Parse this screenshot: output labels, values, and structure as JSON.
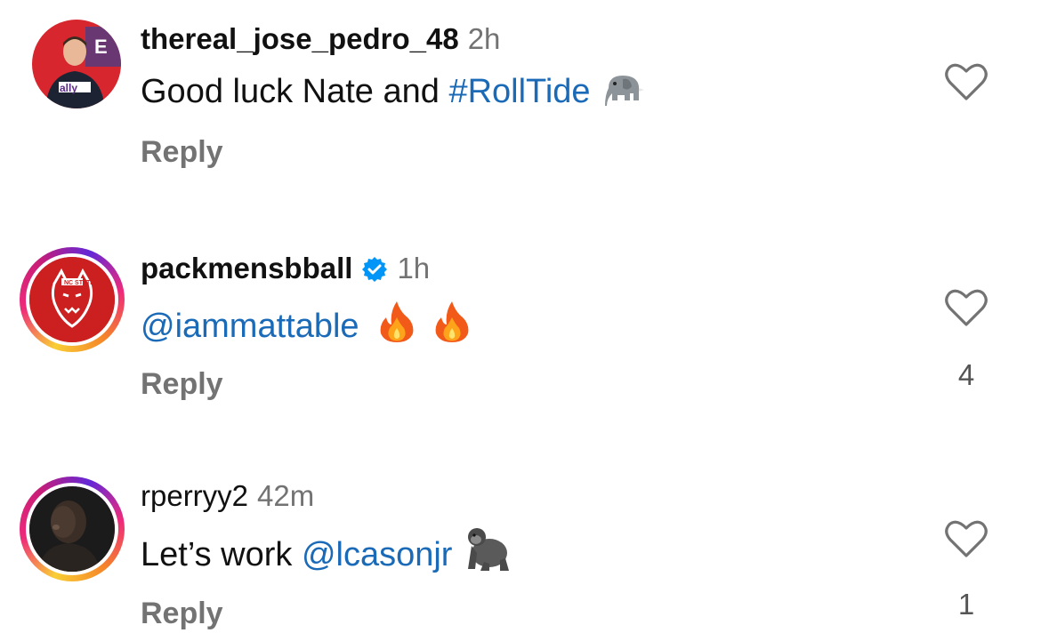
{
  "comments": [
    {
      "username": "thereal_jose_pedro_48",
      "time": "2h",
      "verified": false,
      "text_plain": "Good luck Nate and ",
      "text_link": "#RollTide",
      "emoji": "elephant-emoji",
      "reply_label": "Reply",
      "likes": ""
    },
    {
      "username": "packmensbball",
      "time": "1h",
      "verified": true,
      "text_plain": "",
      "text_link": "@iammattable",
      "emoji": "fire-emoji",
      "reply_label": "Reply",
      "likes": "4"
    },
    {
      "username": "rperryy2",
      "time": "42m",
      "verified": false,
      "text_plain": "Let’s work ",
      "text_link": "@lcasonjr",
      "emoji": "gorilla-emoji",
      "reply_label": "Reply",
      "likes": "1"
    }
  ],
  "colors": {
    "link": "#1a6ab8",
    "muted": "#737373",
    "verified": "#0095f6",
    "wolfpack_red": "#cc1f1f"
  }
}
